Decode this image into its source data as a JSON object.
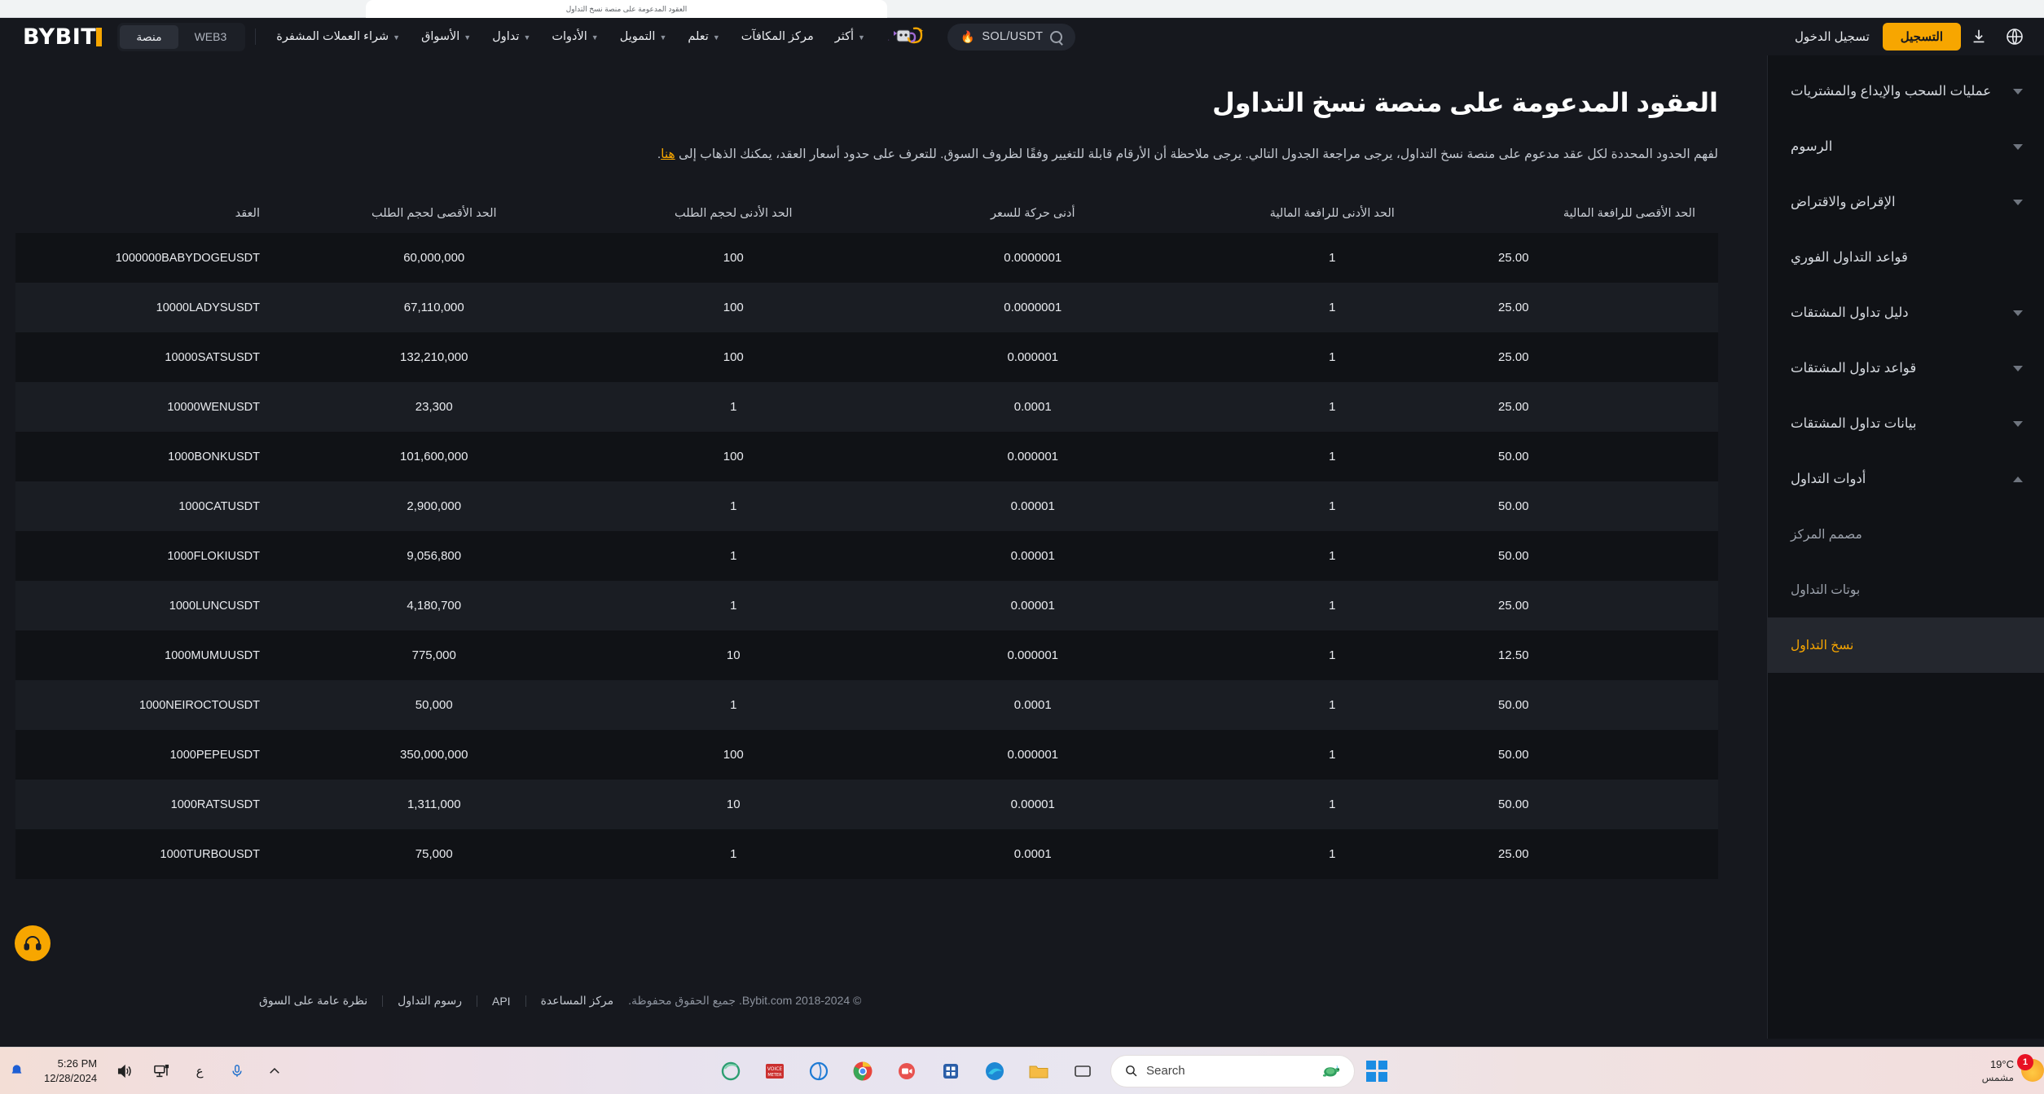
{
  "browser": {
    "tab_title": "العقود المدعومة على منصة نسخ التداول"
  },
  "topnav": {
    "brand": "BYBIT",
    "segments": [
      {
        "label": "منصة",
        "active": true
      },
      {
        "label": "WEB3",
        "active": false
      }
    ],
    "links": [
      {
        "label": "شراء العملات المشفرة",
        "caret": true
      },
      {
        "label": "الأسواق",
        "caret": true
      },
      {
        "label": "تداول",
        "caret": true
      },
      {
        "label": "الأدوات",
        "caret": true
      },
      {
        "label": "التمويل",
        "caret": true
      },
      {
        "label": "تعلم",
        "caret": true
      },
      {
        "label": "مركز المكافآت",
        "caret": false
      },
      {
        "label": "أكثر",
        "caret": true
      }
    ],
    "search": {
      "pair": "SOL/USDT",
      "flame": "🔥",
      "icon": "search-icon"
    },
    "login_label": "تسجيل الدخول",
    "signup_label": "التسجيل",
    "download_icon": "download-icon",
    "globe_icon": "globe-icon"
  },
  "sidebar": {
    "items": [
      {
        "label": "عمليات السحب والإيداع والمشتريات",
        "expandable": true,
        "state": "collapsed",
        "active": false,
        "sub": false
      },
      {
        "label": "الرسوم",
        "expandable": true,
        "state": "collapsed",
        "active": false,
        "sub": false
      },
      {
        "label": "الإقراض والاقتراض",
        "expandable": true,
        "state": "collapsed",
        "active": false,
        "sub": false
      },
      {
        "label": "قواعد التداول الفوري",
        "expandable": false,
        "state": "",
        "active": false,
        "sub": false
      },
      {
        "label": "دليل تداول المشتقات",
        "expandable": true,
        "state": "collapsed",
        "active": false,
        "sub": false
      },
      {
        "label": "قواعد تداول المشتقات",
        "expandable": true,
        "state": "collapsed",
        "active": false,
        "sub": false
      },
      {
        "label": "بيانات تداول المشتقات",
        "expandable": true,
        "state": "collapsed",
        "active": false,
        "sub": false
      },
      {
        "label": "أدوات التداول",
        "expandable": true,
        "state": "expanded",
        "active": false,
        "sub": false
      },
      {
        "label": "مصمم المركز",
        "expandable": false,
        "state": "",
        "active": false,
        "sub": true
      },
      {
        "label": "بوتات التداول",
        "expandable": false,
        "state": "",
        "active": false,
        "sub": true
      },
      {
        "label": "نسخ التداول",
        "expandable": false,
        "state": "",
        "active": true,
        "sub": true
      }
    ]
  },
  "main": {
    "title": "العقود المدعومة على منصة نسخ التداول",
    "description_before": "لفهم الحدود المحددة لكل عقد مدعوم على منصة نسخ التداول، يرجى مراجعة الجدول التالي. يرجى ملاحظة أن الأرقام قابلة للتغيير وفقًا لظروف السوق. للتعرف على حدود أسعار العقد، يمكنك الذهاب إلى ",
    "description_link": "هنا",
    "description_after": "."
  },
  "table": {
    "headers": [
      "الحد الأقصى للرافعة المالية",
      "الحد الأدنى للرافعة المالية",
      "أدنى حركة للسعر",
      "الحد الأدنى لحجم الطلب",
      "الحد الأقصى لحجم الطلب",
      "العقد"
    ],
    "rows": [
      {
        "max_leverage": "25.00",
        "min_leverage": "1",
        "tick_size": "0.0000001",
        "min_order": "100",
        "max_order": "60,000,000",
        "contract": "1000000BABYDOGEUSDT"
      },
      {
        "max_leverage": "25.00",
        "min_leverage": "1",
        "tick_size": "0.0000001",
        "min_order": "100",
        "max_order": "67,110,000",
        "contract": "10000LADYSUSDT"
      },
      {
        "max_leverage": "25.00",
        "min_leverage": "1",
        "tick_size": "0.000001",
        "min_order": "100",
        "max_order": "132,210,000",
        "contract": "10000SATSUSDT"
      },
      {
        "max_leverage": "25.00",
        "min_leverage": "1",
        "tick_size": "0.0001",
        "min_order": "1",
        "max_order": "23,300",
        "contract": "10000WENUSDT"
      },
      {
        "max_leverage": "50.00",
        "min_leverage": "1",
        "tick_size": "0.000001",
        "min_order": "100",
        "max_order": "101,600,000",
        "contract": "1000BONKUSDT"
      },
      {
        "max_leverage": "50.00",
        "min_leverage": "1",
        "tick_size": "0.00001",
        "min_order": "1",
        "max_order": "2,900,000",
        "contract": "1000CATUSDT"
      },
      {
        "max_leverage": "50.00",
        "min_leverage": "1",
        "tick_size": "0.00001",
        "min_order": "1",
        "max_order": "9,056,800",
        "contract": "1000FLOKIUSDT"
      },
      {
        "max_leverage": "25.00",
        "min_leverage": "1",
        "tick_size": "0.00001",
        "min_order": "1",
        "max_order": "4,180,700",
        "contract": "1000LUNCUSDT"
      },
      {
        "max_leverage": "12.50",
        "min_leverage": "1",
        "tick_size": "0.000001",
        "min_order": "10",
        "max_order": "775,000",
        "contract": "1000MUMUUSDT"
      },
      {
        "max_leverage": "50.00",
        "min_leverage": "1",
        "tick_size": "0.0001",
        "min_order": "1",
        "max_order": "50,000",
        "contract": "1000NEIROCTOUSDT"
      },
      {
        "max_leverage": "50.00",
        "min_leverage": "1",
        "tick_size": "0.000001",
        "min_order": "100",
        "max_order": "350,000,000",
        "contract": "1000PEPEUSDT"
      },
      {
        "max_leverage": "50.00",
        "min_leverage": "1",
        "tick_size": "0.00001",
        "min_order": "10",
        "max_order": "1,311,000",
        "contract": "1000RATSUSDT"
      },
      {
        "max_leverage": "25.00",
        "min_leverage": "1",
        "tick_size": "0.0001",
        "min_order": "1",
        "max_order": "75,000",
        "contract": "1000TURBOUSDT"
      }
    ]
  },
  "footer": {
    "links": [
      "مركز المساعدة",
      "API",
      "رسوم التداول",
      "نظرة عامة على السوق"
    ],
    "copyright": "© 2018-2024 Bybit.com. جميع الحقوق محفوظة."
  },
  "support": {
    "icon": "headset-icon"
  },
  "taskbar": {
    "weather_temp": "19°C",
    "weather_desc": "مشمس",
    "weather_badge": "1",
    "search_placeholder": "Search",
    "clock_time": "5:26 PM",
    "clock_date": "12/28/2024",
    "apps": [
      "windows-start-icon",
      "turtle-icon",
      "taskview-icon",
      "file-explorer-icon",
      "edge-icon",
      "store-icon",
      "zoom-icon",
      "chrome-icon",
      "browser-icon",
      "voicemeeter-icon",
      "edge-dev-icon"
    ],
    "tray": [
      "chevron-up-icon",
      "microphone-icon",
      "arabic-input-icon",
      "network-icon",
      "volume-icon",
      "notification-icon"
    ]
  },
  "colors": {
    "accent": "#f7a600",
    "bg": "#16181e",
    "panel": "#101216",
    "row_alt": "#1a1d23"
  }
}
